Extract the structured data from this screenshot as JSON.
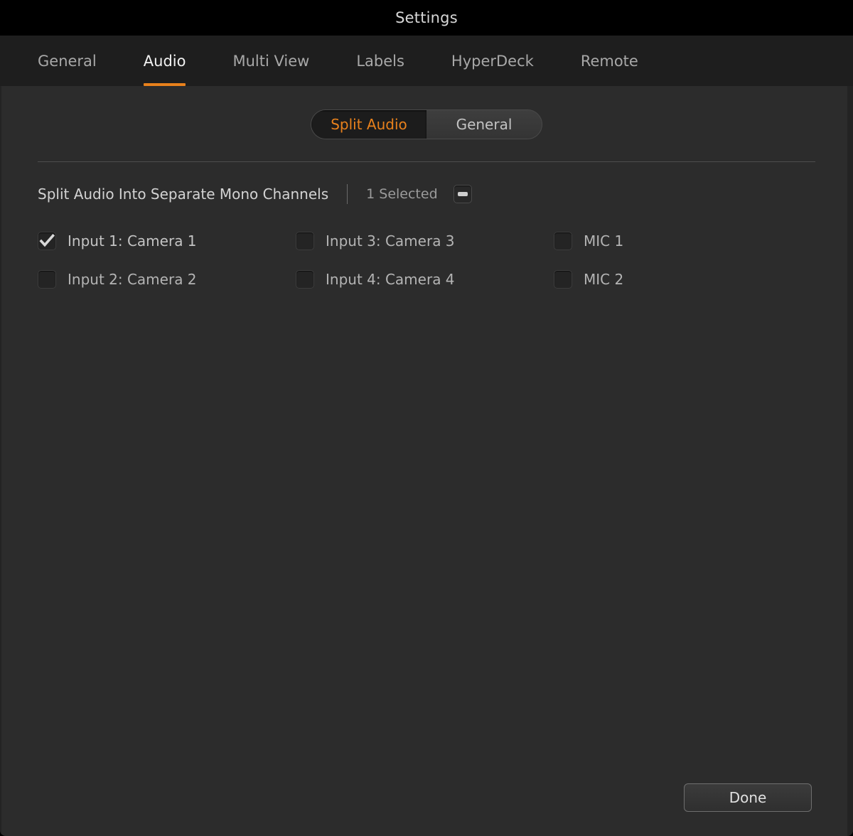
{
  "window": {
    "title": "Settings"
  },
  "tabs": [
    {
      "label": "General",
      "active": false
    },
    {
      "label": "Audio",
      "active": true
    },
    {
      "label": "Multi View",
      "active": false
    },
    {
      "label": "Labels",
      "active": false
    },
    {
      "label": "HyperDeck",
      "active": false
    },
    {
      "label": "Remote",
      "active": false
    }
  ],
  "segmented_control": {
    "selected": "Split Audio",
    "options": [
      {
        "label": "Split Audio",
        "selected": true
      },
      {
        "label": "General",
        "selected": false
      }
    ]
  },
  "split_audio_section": {
    "header_label": "Split Audio Into Separate Mono Channels",
    "selected_count": "1 Selected",
    "select_all_state": "indeterminate",
    "channels": [
      {
        "label": "Input 1: Camera 1",
        "checked": true
      },
      {
        "label": "Input 3: Camera 3",
        "checked": false
      },
      {
        "label": "MIC 1",
        "checked": false
      },
      {
        "label": "Input 2: Camera 2",
        "checked": false
      },
      {
        "label": "Input 4: Camera 4",
        "checked": false
      },
      {
        "label": "MIC 2",
        "checked": false
      }
    ]
  },
  "footer": {
    "done_label": "Done"
  },
  "colors": {
    "accent": "#e8811c",
    "titlebar_bg": "#000000",
    "tabbar_bg": "#1e1e1e",
    "content_bg": "#2c2c2c",
    "text_primary": "#d8d8d8",
    "text_secondary": "#9b9b9b"
  }
}
